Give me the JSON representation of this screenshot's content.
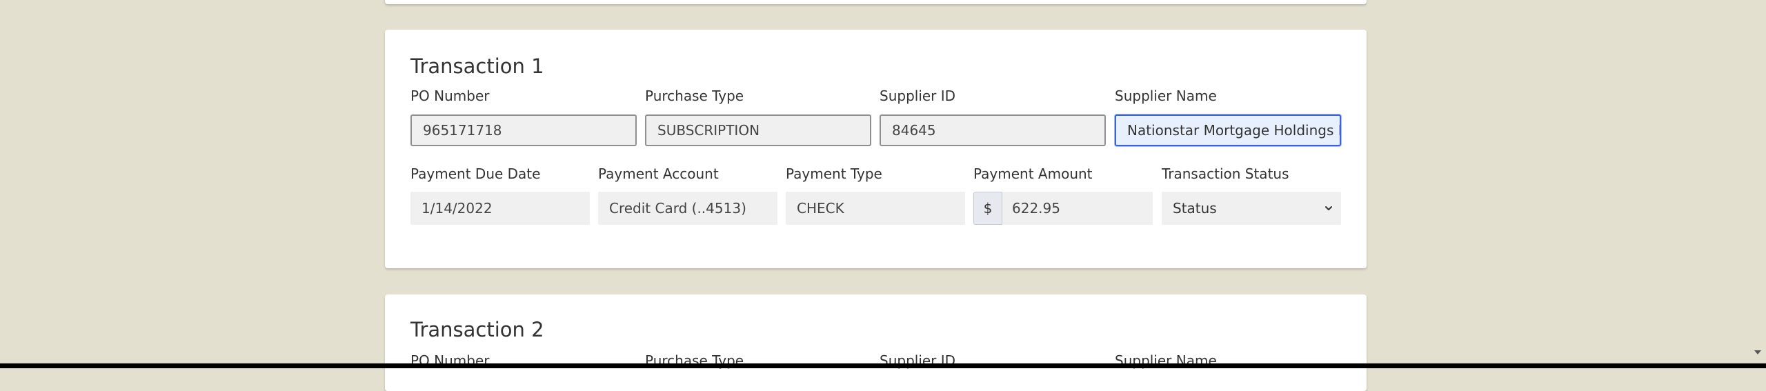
{
  "transactions": [
    {
      "title": "Transaction 1",
      "po_number_label": "PO Number",
      "po_number": "965171718",
      "purchase_type_label": "Purchase Type",
      "purchase_type": "SUBSCRIPTION",
      "supplier_id_label": "Supplier ID",
      "supplier_id": "84645",
      "supplier_name_label": "Supplier Name",
      "supplier_name": "Nationstar Mortgage Holdings In",
      "payment_due_date_label": "Payment Due Date",
      "payment_due_date": "1/14/2022",
      "payment_account_label": "Payment Account",
      "payment_account": "Credit Card (..4513)",
      "payment_type_label": "Payment Type",
      "payment_type": "CHECK",
      "payment_amount_label": "Payment Amount",
      "currency_symbol": "$",
      "payment_amount": "622.95",
      "transaction_status_label": "Transaction Status",
      "transaction_status_selected": "Status"
    },
    {
      "title": "Transaction 2",
      "po_number_label": "PO Number",
      "purchase_type_label": "Purchase Type",
      "supplier_id_label": "Supplier ID",
      "supplier_name_label": "Supplier Name"
    }
  ],
  "icons": {
    "select_chevron": "chevron-down-icon",
    "scroll_down": "scroll-down-arrow-icon"
  },
  "colors": {
    "page_background": "#e3e0cf",
    "focus_border": "#3b63d8",
    "focus_background": "#e8f0fe"
  }
}
